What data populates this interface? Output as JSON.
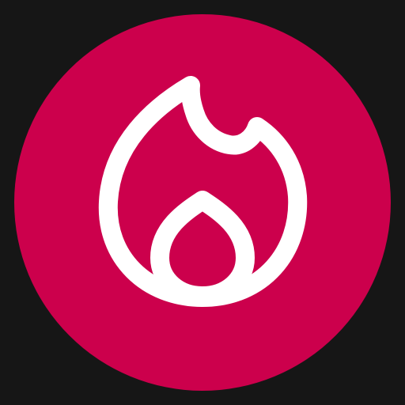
{
  "icon": {
    "name": "fire-icon",
    "background_color": "#161616",
    "circle_color": "#cc004c",
    "stroke_color": "#ffffff"
  }
}
